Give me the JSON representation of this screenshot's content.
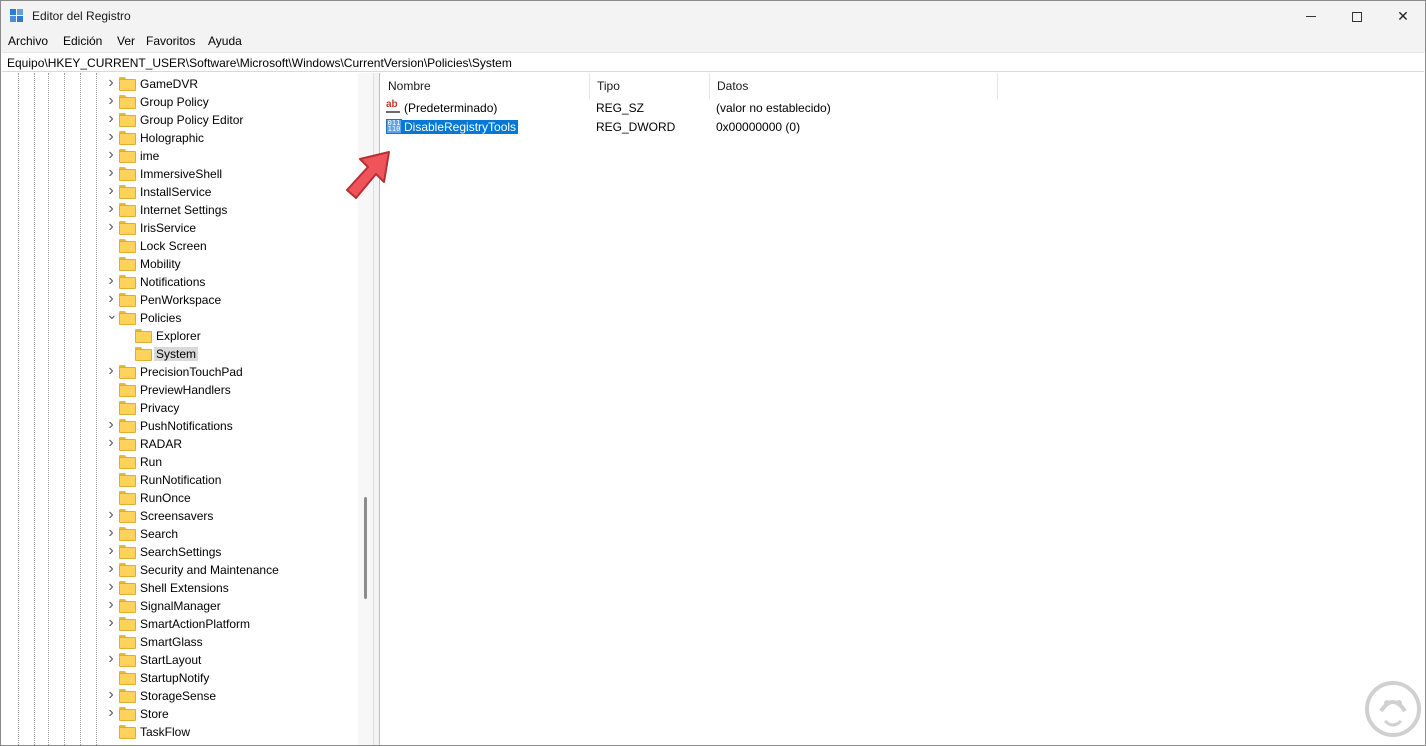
{
  "window": {
    "title": "Editor del Registro",
    "icon": "registry-editor-icon"
  },
  "menu": {
    "items": [
      "Archivo",
      "Edición",
      "Ver",
      "Favoritos",
      "Ayuda"
    ]
  },
  "address": {
    "path": "Equipo\\HKEY_CURRENT_USER\\Software\\Microsoft\\Windows\\CurrentVersion\\Policies\\System"
  },
  "tree": {
    "items": [
      {
        "label": "GameDVR",
        "expandable": true,
        "level": 0
      },
      {
        "label": "Group Policy",
        "expandable": true,
        "level": 0
      },
      {
        "label": "Group Policy Editor",
        "expandable": true,
        "level": 0
      },
      {
        "label": "Holographic",
        "expandable": true,
        "level": 0
      },
      {
        "label": "ime",
        "expandable": true,
        "level": 0
      },
      {
        "label": "ImmersiveShell",
        "expandable": true,
        "level": 0
      },
      {
        "label": "InstallService",
        "expandable": true,
        "level": 0
      },
      {
        "label": "Internet Settings",
        "expandable": true,
        "level": 0
      },
      {
        "label": "IrisService",
        "expandable": true,
        "level": 0
      },
      {
        "label": "Lock Screen",
        "expandable": false,
        "level": 0
      },
      {
        "label": "Mobility",
        "expandable": false,
        "level": 0
      },
      {
        "label": "Notifications",
        "expandable": true,
        "level": 0
      },
      {
        "label": "PenWorkspace",
        "expandable": true,
        "level": 0
      },
      {
        "label": "Policies",
        "expandable": true,
        "expanded": true,
        "level": 0
      },
      {
        "label": "Explorer",
        "expandable": false,
        "level": 1
      },
      {
        "label": "System",
        "expandable": false,
        "level": 1,
        "selected": true
      },
      {
        "label": "PrecisionTouchPad",
        "expandable": true,
        "level": 0
      },
      {
        "label": "PreviewHandlers",
        "expandable": false,
        "level": 0
      },
      {
        "label": "Privacy",
        "expandable": false,
        "level": 0
      },
      {
        "label": "PushNotifications",
        "expandable": true,
        "level": 0
      },
      {
        "label": "RADAR",
        "expandable": true,
        "level": 0
      },
      {
        "label": "Run",
        "expandable": false,
        "level": 0
      },
      {
        "label": "RunNotification",
        "expandable": false,
        "level": 0
      },
      {
        "label": "RunOnce",
        "expandable": false,
        "level": 0
      },
      {
        "label": "Screensavers",
        "expandable": true,
        "level": 0
      },
      {
        "label": "Search",
        "expandable": true,
        "level": 0
      },
      {
        "label": "SearchSettings",
        "expandable": true,
        "level": 0
      },
      {
        "label": "Security and Maintenance",
        "expandable": true,
        "level": 0
      },
      {
        "label": "Shell Extensions",
        "expandable": true,
        "level": 0
      },
      {
        "label": "SignalManager",
        "expandable": true,
        "level": 0
      },
      {
        "label": "SmartActionPlatform",
        "expandable": true,
        "level": 0
      },
      {
        "label": "SmartGlass",
        "expandable": false,
        "level": 0
      },
      {
        "label": "StartLayout",
        "expandable": true,
        "level": 0
      },
      {
        "label": "StartupNotify",
        "expandable": false,
        "level": 0
      },
      {
        "label": "StorageSense",
        "expandable": true,
        "level": 0
      },
      {
        "label": "Store",
        "expandable": true,
        "level": 0
      },
      {
        "label": "TaskFlow",
        "expandable": false,
        "level": 0
      }
    ]
  },
  "list": {
    "headers": {
      "name": "Nombre",
      "type": "Tipo",
      "data": "Datos"
    },
    "rows": [
      {
        "icon": "string-value-icon",
        "name": "(Predeterminado)",
        "type": "REG_SZ",
        "data": "(valor no establecido)",
        "selected": false
      },
      {
        "icon": "binary-value-icon",
        "name": "DisableRegistryTools",
        "type": "REG_DWORD",
        "data": "0x00000000 (0)",
        "selected": true
      }
    ]
  },
  "colors": {
    "selection": "#0078d7",
    "folder": "#ffd25c",
    "annotation_arrow": "#f0545a"
  }
}
